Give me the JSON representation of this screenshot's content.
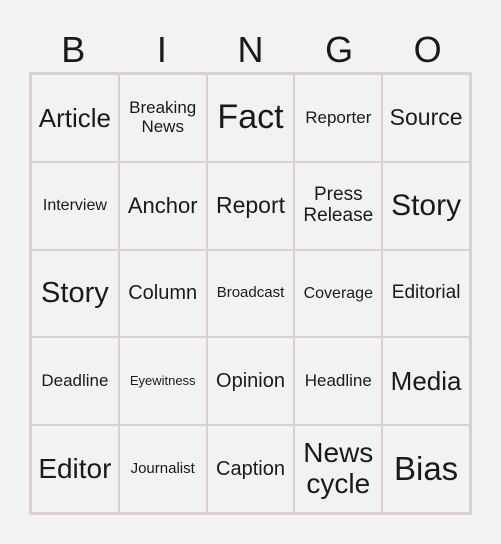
{
  "header": [
    "B",
    "I",
    "N",
    "G",
    "O"
  ],
  "cells": [
    {
      "text": "Article",
      "size": 26
    },
    {
      "text": "Breaking News",
      "size": 17
    },
    {
      "text": "Fact",
      "size": 34
    },
    {
      "text": "Reporter",
      "size": 17
    },
    {
      "text": "Source",
      "size": 23
    },
    {
      "text": "Interview",
      "size": 16
    },
    {
      "text": "Anchor",
      "size": 22
    },
    {
      "text": "Report",
      "size": 23
    },
    {
      "text": "Press Release",
      "size": 19
    },
    {
      "text": "Story",
      "size": 30
    },
    {
      "text": "Story",
      "size": 29
    },
    {
      "text": "Column",
      "size": 20
    },
    {
      "text": "Broadcast",
      "size": 15
    },
    {
      "text": "Coverage",
      "size": 16
    },
    {
      "text": "Editorial",
      "size": 19
    },
    {
      "text": "Deadline",
      "size": 17
    },
    {
      "text": "Eyewitness",
      "size": 13
    },
    {
      "text": "Opinion",
      "size": 20
    },
    {
      "text": "Headline",
      "size": 17
    },
    {
      "text": "Media",
      "size": 26
    },
    {
      "text": "Editor",
      "size": 28
    },
    {
      "text": "Journalist",
      "size": 15
    },
    {
      "text": "Caption",
      "size": 20
    },
    {
      "text": "News cycle",
      "size": 28
    },
    {
      "text": "Bias",
      "size": 33
    }
  ]
}
